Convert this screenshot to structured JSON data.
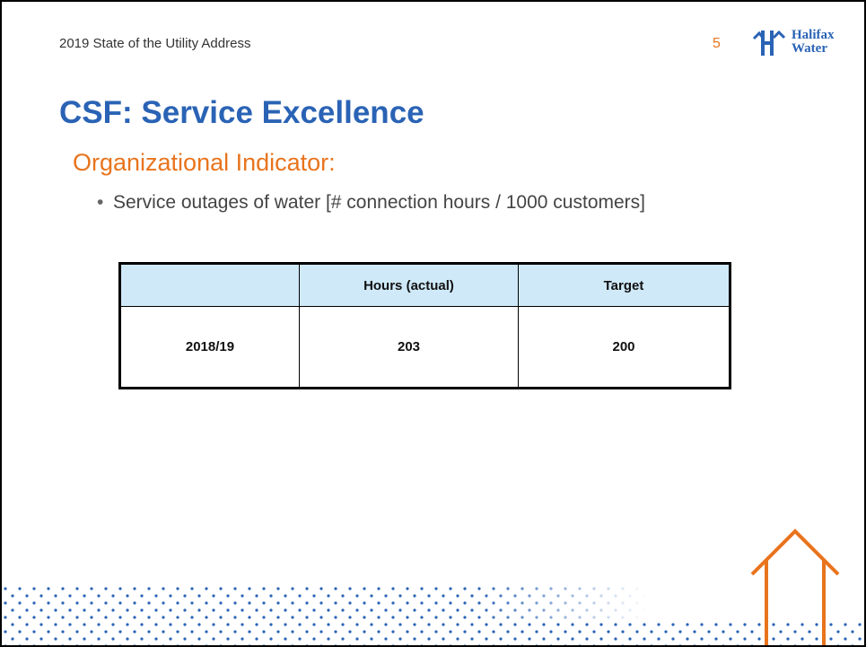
{
  "header": {
    "title": "2019 State of the Utility Address",
    "page_number": "5"
  },
  "logo": {
    "line1": "Halifax",
    "line2": "Water",
    "icon": "halifax-water-logo-icon"
  },
  "main": {
    "title": "CSF: Service Excellence",
    "subheading": "Organizational Indicator:",
    "bullet_symbol": "•",
    "bullet": "Service outages of water [# connection hours / 1000 customers]"
  },
  "table": {
    "headers": [
      "",
      "Hours (actual)",
      "Target"
    ],
    "rows": [
      [
        "2018/19",
        "203",
        "200"
      ]
    ]
  },
  "colors": {
    "brand_blue": "#2a63b5",
    "accent_orange": "#e8741d",
    "header_fill": "#cfe9f9"
  },
  "decorations": {
    "dot_pattern": "dot-pattern",
    "house_outline": "house-outline-icon"
  }
}
